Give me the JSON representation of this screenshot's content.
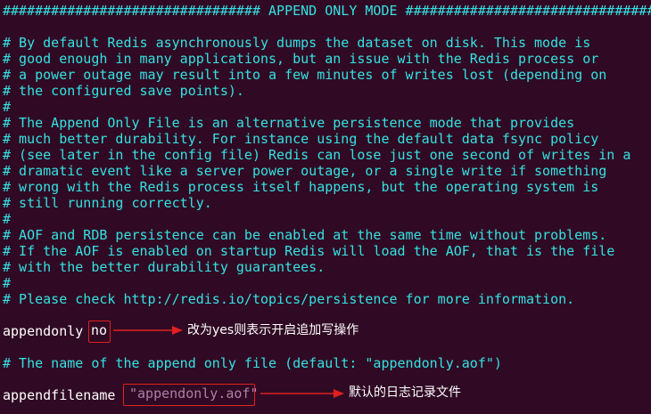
{
  "header": "################################ APPEND ONLY MODE ###############################",
  "comment_block_1": [
    "# By default Redis asynchronously dumps the dataset on disk. This mode is",
    "# good enough in many applications, but an issue with the Redis process or",
    "# a power outage may result into a few minutes of writes lost (depending on",
    "# the configured save points).",
    "#",
    "# The Append Only File is an alternative persistence mode that provides",
    "# much better durability. For instance using the default data fsync policy",
    "# (see later in the config file) Redis can lose just one second of writes in a",
    "# dramatic event like a server power outage, or a single write if something",
    "# wrong with the Redis process itself happens, but the operating system is",
    "# still running correctly.",
    "#",
    "# AOF and RDB persistence can be enabled at the same time without problems.",
    "# If the AOF is enabled on startup Redis will load the AOF, that is the file",
    "# with the better durability guarantees.",
    "#",
    "# Please check http://redis.io/topics/persistence for more information."
  ],
  "appendonly": {
    "key": "appendonly",
    "value": "no",
    "note": "改为yes则表示开启追加写操作"
  },
  "filename_comment": "# The name of the append only file (default: \"appendonly.aof\")",
  "appendfilename": {
    "key": "appendfilename",
    "value": "\"appendonly.aof\"",
    "note": "默认的日志记录文件"
  },
  "colors": {
    "background": "#300a24",
    "comment": "#34e2e2",
    "text": "#ffffff",
    "string": "#ad7fa8",
    "annotation": "#e02020"
  }
}
